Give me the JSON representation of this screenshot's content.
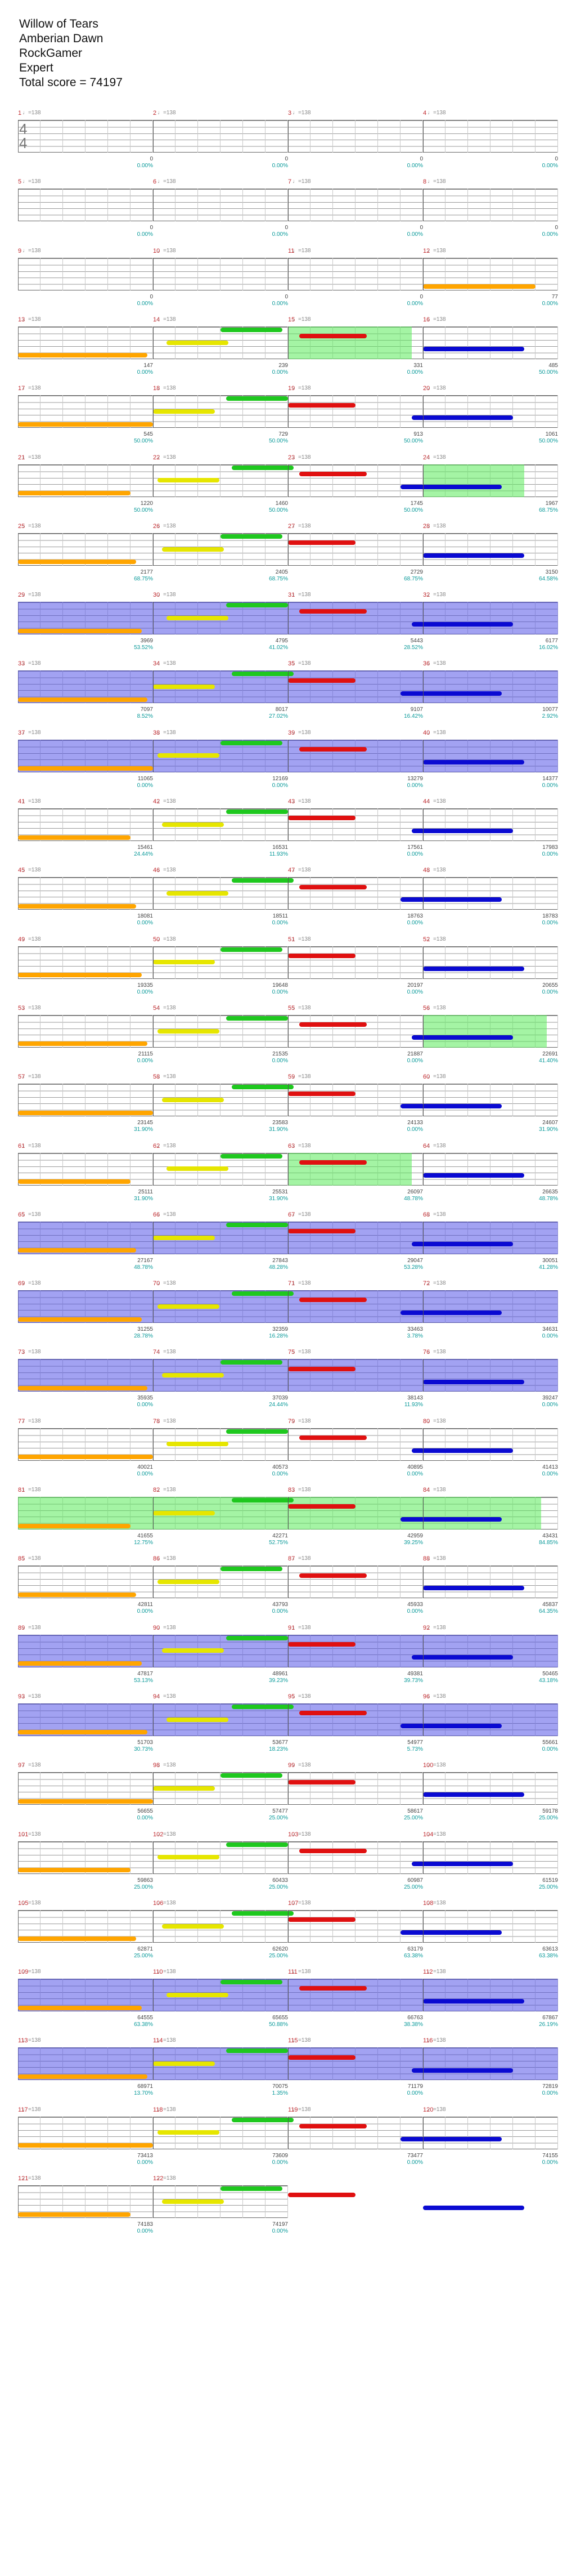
{
  "song": {
    "title": "Willow of Tears",
    "artist": "Amberian Dawn",
    "charter": "RockGamer",
    "difficulty": "Expert",
    "total_score": "Total score = 74197"
  },
  "time_signature": {
    "top": "4",
    "bottom": "4"
  },
  "bpm_marker": "♩=138",
  "rows": [
    {
      "measures": [
        "1",
        "2",
        "3",
        "4"
      ],
      "scores": [
        "0",
        "0",
        "0",
        "0"
      ],
      "pcts": [
        "0.00%",
        "0.00%",
        "0.00%",
        "0.00%"
      ]
    },
    {
      "measures": [
        "5",
        "6",
        "7",
        "8"
      ],
      "scores": [
        "0",
        "0",
        "0",
        "0"
      ],
      "pcts": [
        "0.00%",
        "0.00%",
        "0.00%",
        "0.00%"
      ]
    },
    {
      "measures": [
        "9",
        "10",
        "11",
        "12"
      ],
      "scores": [
        "0",
        "0",
        "0",
        "77"
      ],
      "pcts": [
        "0.00%",
        "0.00%",
        "0.00%",
        "0.00%"
      ]
    },
    {
      "measures": [
        "13",
        "14",
        "15",
        "16"
      ],
      "scores": [
        "147",
        "239",
        "331",
        "485"
      ],
      "pcts": [
        "0.00%",
        "0.00%",
        "0.00%",
        "50.00%"
      ]
    },
    {
      "measures": [
        "17",
        "18",
        "19",
        "20"
      ],
      "scores": [
        "545",
        "729",
        "913",
        "1061"
      ],
      "pcts": [
        "50.00%",
        "50.00%",
        "50.00%",
        "50.00%"
      ]
    },
    {
      "measures": [
        "21",
        "22",
        "23",
        "24"
      ],
      "scores": [
        "1220",
        "1460",
        "1745",
        "1967"
      ],
      "pcts": [
        "50.00%",
        "50.00%",
        "50.00%",
        "68.75%"
      ]
    },
    {
      "measures": [
        "25",
        "26",
        "27",
        "28"
      ],
      "scores": [
        "2177",
        "2405",
        "2729",
        "3150"
      ],
      "pcts": [
        "68.75%",
        "68.75%",
        "68.75%",
        "64.58%"
      ]
    },
    {
      "measures": [
        "29",
        "30",
        "31",
        "32"
      ],
      "scores": [
        "3969",
        "4795",
        "5443",
        "6177"
      ],
      "pcts": [
        "53.52%",
        "41.02%",
        "28.52%",
        "16.02%"
      ]
    },
    {
      "measures": [
        "33",
        "34",
        "35",
        "36"
      ],
      "scores": [
        "7097",
        "8017",
        "9107",
        "10077"
      ],
      "pcts": [
        "8.52%",
        "27.02%",
        "16.42%",
        "2.92%"
      ]
    },
    {
      "measures": [
        "37",
        "38",
        "39",
        "40"
      ],
      "scores": [
        "11065",
        "12169",
        "13279",
        "14377"
      ],
      "pcts": [
        "0.00%",
        "0.00%",
        "0.00%",
        "0.00%"
      ]
    },
    {
      "measures": [
        "41",
        "42",
        "43",
        "44"
      ],
      "scores": [
        "15461",
        "16531",
        "17561",
        "17983"
      ],
      "pcts": [
        "24.44%",
        "11.93%",
        "0.00%",
        "0.00%"
      ]
    },
    {
      "measures": [
        "45",
        "46",
        "47",
        "48"
      ],
      "scores": [
        "18081",
        "18511",
        "18763",
        "18783"
      ],
      "pcts": [
        "0.00%",
        "0.00%",
        "0.00%",
        "0.00%"
      ]
    },
    {
      "measures": [
        "49",
        "50",
        "51",
        "52"
      ],
      "scores": [
        "19335",
        "19648",
        "20197",
        "20655"
      ],
      "pcts": [
        "0.00%",
        "0.00%",
        "0.00%",
        "0.00%"
      ]
    },
    {
      "measures": [
        "53",
        "54",
        "55",
        "56"
      ],
      "scores": [
        "21115",
        "21535",
        "21887",
        "22691"
      ],
      "pcts": [
        "0.00%",
        "0.00%",
        "0.00%",
        "41.40%"
      ]
    },
    {
      "measures": [
        "57",
        "58",
        "59",
        "60"
      ],
      "scores": [
        "23145",
        "23583",
        "24133",
        "24607"
      ],
      "pcts": [
        "31.90%",
        "31.90%",
        "0.00%",
        "31.90%"
      ]
    },
    {
      "measures": [
        "61",
        "62",
        "63",
        "64"
      ],
      "scores": [
        "25111",
        "25531",
        "26097",
        "26635"
      ],
      "pcts": [
        "31.90%",
        "31.90%",
        "48.78%",
        "48.78%"
      ]
    },
    {
      "measures": [
        "65",
        "66",
        "67",
        "68"
      ],
      "scores": [
        "27167",
        "27843",
        "29047",
        "30051"
      ],
      "pcts": [
        "48.78%",
        "48.28%",
        "53.28%",
        "41.28%"
      ]
    },
    {
      "measures": [
        "69",
        "70",
        "71",
        "72"
      ],
      "scores": [
        "31255",
        "32359",
        "33463",
        "34631"
      ],
      "pcts": [
        "28.78%",
        "16.28%",
        "3.78%",
        "0.00%"
      ]
    },
    {
      "measures": [
        "73",
        "74",
        "75",
        "76"
      ],
      "scores": [
        "35935",
        "37039",
        "38143",
        "39247"
      ],
      "pcts": [
        "0.00%",
        "24.44%",
        "11.93%",
        "0.00%"
      ]
    },
    {
      "measures": [
        "77",
        "78",
        "79",
        "80"
      ],
      "scores": [
        "40021",
        "40573",
        "40895",
        "41413"
      ],
      "pcts": [
        "0.00%",
        "0.00%",
        "0.00%",
        "0.00%"
      ]
    },
    {
      "measures": [
        "81",
        "82",
        "83",
        "84"
      ],
      "scores": [
        "41655",
        "42271",
        "42959",
        "43431"
      ],
      "pcts": [
        "12.75%",
        "52.75%",
        "39.25%",
        "84.85%"
      ]
    },
    {
      "measures": [
        "85",
        "86",
        "87",
        "88"
      ],
      "scores": [
        "42811",
        "43793",
        "45933",
        "45837"
      ],
      "pcts": [
        "0.00%",
        "0.00%",
        "0.00%",
        "64.35%"
      ]
    },
    {
      "measures": [
        "89",
        "90",
        "91",
        "92"
      ],
      "scores": [
        "47817",
        "48961",
        "49381",
        "50465"
      ],
      "pcts": [
        "53.13%",
        "39.23%",
        "39.73%",
        "43.18%"
      ]
    },
    {
      "measures": [
        "93",
        "94",
        "95",
        "96"
      ],
      "scores": [
        "51703",
        "53677",
        "54977",
        "55661"
      ],
      "pcts": [
        "30.73%",
        "18.23%",
        "5.73%",
        "0.00%"
      ]
    },
    {
      "measures": [
        "97",
        "98",
        "99",
        "100"
      ],
      "scores": [
        "56655",
        "57477",
        "58617",
        "59178"
      ],
      "pcts": [
        "0.00%",
        "25.00%",
        "25.00%",
        "25.00%"
      ]
    },
    {
      "measures": [
        "101",
        "102",
        "103",
        "104"
      ],
      "scores": [
        "59863",
        "60433",
        "60987",
        "61519"
      ],
      "pcts": [
        "25.00%",
        "25.00%",
        "25.00%",
        "25.00%"
      ]
    },
    {
      "measures": [
        "105",
        "106",
        "107",
        "108"
      ],
      "scores": [
        "62871",
        "62620",
        "63179",
        "63613"
      ],
      "pcts": [
        "25.00%",
        "25.00%",
        "63.38%",
        "63.38%"
      ]
    },
    {
      "measures": [
        "109",
        "110",
        "111",
        "112"
      ],
      "scores": [
        "64555",
        "65655",
        "66763",
        "67867"
      ],
      "pcts": [
        "63.38%",
        "50.88%",
        "38.38%",
        "26.19%"
      ]
    },
    {
      "measures": [
        "113",
        "114",
        "115",
        "116"
      ],
      "scores": [
        "68971",
        "70075",
        "71179",
        "72819"
      ],
      "pcts": [
        "13.70%",
        "1.35%",
        "0.00%",
        "0.00%"
      ]
    },
    {
      "measures": [
        "117",
        "118",
        "119",
        "120"
      ],
      "scores": [
        "73413",
        "73609",
        "73477",
        "74155"
      ],
      "pcts": [
        "0.00%",
        "0.00%",
        "0.00%",
        "0.00%"
      ]
    },
    {
      "measures": [
        "121",
        "122"
      ],
      "scores": [
        "74183",
        "74197"
      ],
      "pcts": [
        "0.00%",
        "0.00%"
      ]
    }
  ],
  "lane_colors": {
    "green": "#1ec81e",
    "red": "#e01010",
    "yellow": "#e6e600",
    "blue": "#0a0ad2",
    "orange": "#ffa500",
    "star_power": "#4646e6",
    "overdrive_zone": "#5aeb5a",
    "measure_number": "#c0282d",
    "percentage": "#0a9a9a"
  }
}
